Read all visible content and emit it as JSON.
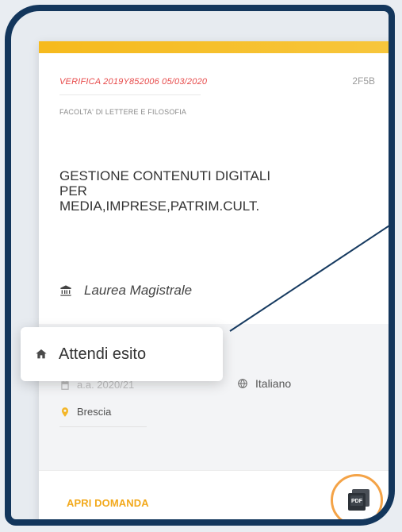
{
  "card": {
    "verification": "VERIFICA 2019Y852006 05/03/2020",
    "code": "2F5B",
    "faculty": "FACOLTA' DI LETTERE E FILOSOFIA",
    "course_title_line1": "GESTIONE CONTENUTI DIGITALI",
    "course_title_line2": "PER",
    "course_title_line3": "MEDIA,IMPRESE,PATRIM.CULT.",
    "degree_type": "Laurea Magistrale",
    "year_obscured": "a.a. 2020/21",
    "language": "Italiano",
    "location": "Brescia",
    "open_label": "APRI DOMANDA"
  },
  "popover": {
    "status": "Attendi esito"
  },
  "colors": {
    "frame": "#13365C",
    "accent": "#F6BA1D",
    "action": "#F2A91C",
    "highlight": "#F4A347",
    "warning": "#E74A4A"
  },
  "icons": {
    "degree": "bank-icon",
    "language": "globe-icon",
    "location": "map-pin-icon",
    "status": "home-icon",
    "pdf": "pdf-icon",
    "menu": "more-vert-icon"
  }
}
